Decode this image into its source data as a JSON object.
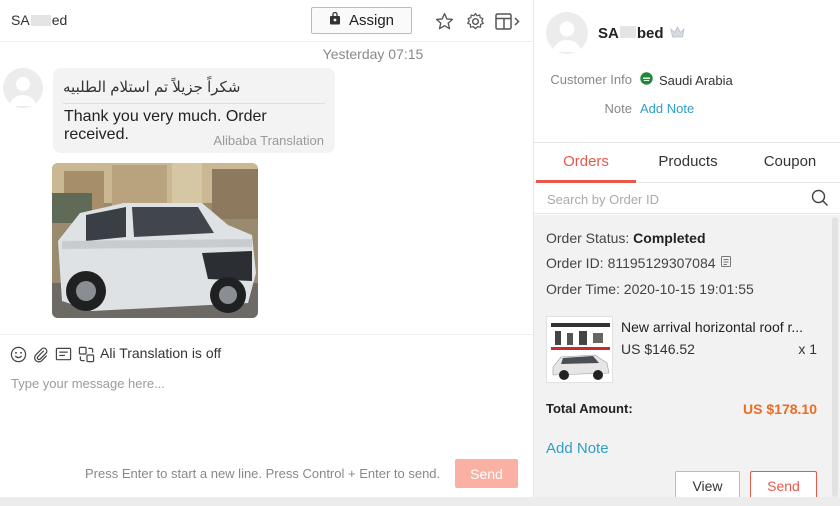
{
  "chat": {
    "contact_name_start": "SA",
    "contact_name_end": "ed",
    "assign_label": "Assign",
    "timestamp": "Yesterday 07:15",
    "message": {
      "original": "شكراً جزيلاً تم استلام الطلبيه",
      "translation": "Thank you very much. Order received.",
      "translation_source": "Alibaba Translation"
    },
    "composer": {
      "translation_status": "Ali Translation is off",
      "placeholder": "Type your message here...",
      "hint": "Press Enter to start a new line. Press Control + Enter to send.",
      "send_label": "Send"
    }
  },
  "customer": {
    "name_start": "SA",
    "name_end": "bed",
    "info_label": "Customer Info",
    "country": "Saudi Arabia",
    "note_label": "Note",
    "add_note_label": "Add Note"
  },
  "tabs": [
    {
      "label": "Orders",
      "active": true
    },
    {
      "label": "Products",
      "active": false
    },
    {
      "label": "Coupon",
      "active": false
    }
  ],
  "search": {
    "placeholder": "Search by Order ID"
  },
  "order": {
    "status_label": "Order Status:",
    "status_value": "Completed",
    "id_label": "Order ID:",
    "id_value": "81195129307084",
    "time_label": "Order Time:",
    "time_value": "2020-10-15 19:01:55",
    "product_title": "New arrival horizontal roof r...",
    "product_price": "US $146.52",
    "product_qty": "x 1",
    "total_label": "Total Amount:",
    "total_value": "US $178.10",
    "add_note_label": "Add Note",
    "view_label": "View",
    "send_label": "Send"
  },
  "colors": {
    "accent": "#e8584a",
    "link": "#2f9ec9",
    "price": "#ef6a1f",
    "send_disabled": "#fab1a4"
  },
  "icons": [
    "shopping-bag-icon",
    "star-icon",
    "gear-icon",
    "panel-toggle-icon",
    "emoji-icon",
    "paperclip-icon",
    "quick-reply-icon",
    "translate-icon",
    "search-icon",
    "copy-icon",
    "crown-icon",
    "saudi-flag-icon"
  ]
}
